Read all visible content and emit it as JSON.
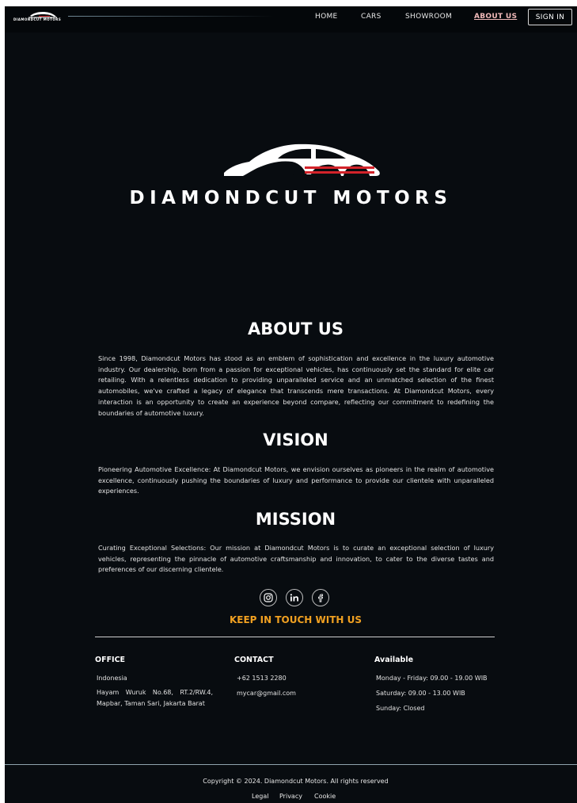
{
  "nav": {
    "logo_text": "DIAMONDCUT MOTORS",
    "links": [
      "HOME",
      "CARS",
      "SHOWROOM",
      "ABOUT US"
    ],
    "active": "ABOUT US",
    "signin_label": "SIGN IN"
  },
  "hero": {
    "brand_name": "DIAMONDCUT MOTORS"
  },
  "about": {
    "title": "ABOUT US",
    "text": "Since 1998, Diamondcut Motors has stood as an emblem of sophistication and excellence in the luxury automotive industry. Our dealership, born from a passion for exceptional vehicles, has continuously set the standard for elite car retailing. With a relentless dedication to providing unparalleled service and an unmatched selection of the finest automobiles, we've crafted a legacy of elegance that transcends mere transactions. At Diamondcut Motors, every interaction is an opportunity to create an experience beyond compare, reflecting our commitment to redefining the boundaries of automotive luxury."
  },
  "vision": {
    "title": "VISION",
    "text": "Pioneering Automotive Excellence: At Diamondcut Motors, we envision ourselves as pioneers in the realm of automotive excellence, continuously pushing the boundaries of luxury and performance to provide our clientele with unparalleled experiences."
  },
  "mission": {
    "title": "MISSION",
    "text": "Curating Exceptional Selections: Our mission at Diamondcut Motors is to curate an exceptional selection of luxury vehicles, representing the pinnacle of automotive craftsmanship and innovation, to cater to the diverse tastes and preferences of our discerning clientele."
  },
  "socials": {
    "icons": [
      "instagram-icon",
      "linkedin-icon",
      "facebook-icon"
    ]
  },
  "contact_section": {
    "keep_in_touch": "KEEP IN TOUCH WITH US",
    "office": {
      "title": "OFFICE",
      "country": "Indonesia",
      "address": "Hayam Wuruk No.68, RT.2/RW.4, Mapbar, Taman Sari, Jakarta Barat"
    },
    "contact": {
      "title": "CONTACT",
      "phone": "+62 1513 2280",
      "email": "mycar@gmail.com"
    },
    "available": {
      "title": "Available",
      "weekdays": "Monday - Friday: 09.00 - 19.00 WIB",
      "saturday": "Saturday: 09.00 - 13.00 WIB",
      "sunday": "Sunday: Closed"
    }
  },
  "footer": {
    "copyright": "Copyright © 2024. Diamondcut Motors. All rights reserved",
    "links": [
      "Legal",
      "Privacy",
      "Cookie"
    ]
  },
  "colors": {
    "background": "#080c10",
    "accent": "#f0a021",
    "nav_active": "#f0b9b9",
    "logo_stripe": "#d3232a"
  }
}
